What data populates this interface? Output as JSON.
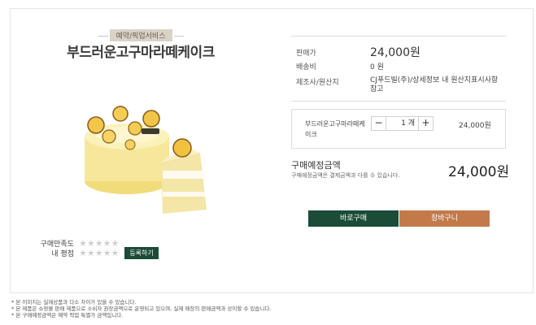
{
  "product": {
    "tag": "예약/픽업서비스",
    "title": "부드러운고구마라떼케이크"
  },
  "rating": {
    "satisfaction_label": "구매만족도",
    "my_rating_label": "내 평점",
    "satisfaction_stars": "★★★★★",
    "my_rating_stars": "★★★★★",
    "register_label": "등록하기"
  },
  "info": {
    "price_label": "판매가",
    "price_value": "24,000원",
    "shipping_label": "배송비",
    "shipping_value": "0 원",
    "origin_label": "제조사/원산지",
    "origin_value": "CJ푸드빌(주)/상세정보 내 원산지표시사항 참고"
  },
  "option": {
    "name": "부드러운고구마라떼케이크",
    "minus": "−",
    "quantity": "1 개",
    "plus": "+",
    "price": "24,000원"
  },
  "total": {
    "label": "구매예정금액",
    "note": "구매예정금액은 결제금액과 다를 수 있습니다.",
    "amount": "24,000원"
  },
  "actions": {
    "buy_now": "바로구매",
    "cart": "장바구니"
  },
  "notes": [
    "* 본 이미지는 실제상품과 다소 차이가 있을 수 있습니다.",
    "* 본 제품은 쇼핑몰 판매 제품으로 소비자 권장금액으로 운영되고 있으며, 실제 매장의 판매금액과 상이할 수 있습니다.",
    "* 본 구매예정금액은 예약 픽업 특별가 금액입니다."
  ],
  "colors": {
    "primary_green": "#1b4c37",
    "cart_brown": "#c27a4b"
  }
}
